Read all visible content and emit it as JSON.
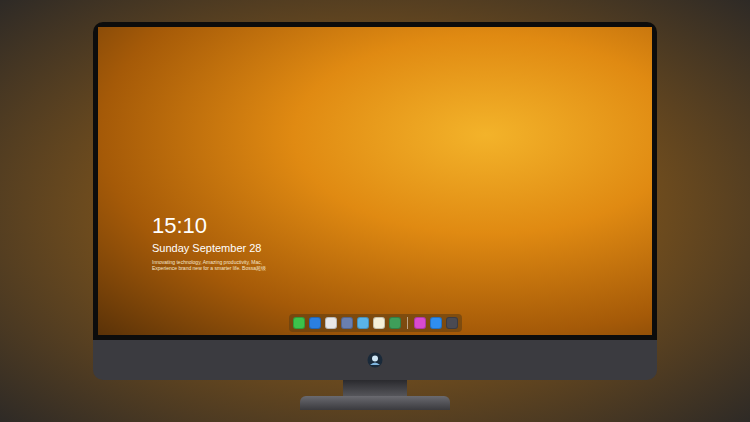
{
  "screen": {
    "clock": {
      "time": "15:10",
      "date": "Sunday September 28",
      "tagline": [
        "Innovating technology, Amazing productivity, Mac,",
        "Experience brand new for a smarter life. Bossa超级"
      ]
    }
  },
  "dock": {
    "items": [
      {
        "color": "#3cc24a"
      },
      {
        "color": "#2a7fe0"
      },
      {
        "color": "#e8e8e8"
      },
      {
        "color": "#6a7fb0"
      },
      {
        "color": "#5ab4e8"
      },
      {
        "color": "#f5f0d8"
      },
      {
        "color": "#3f9e5a"
      }
    ],
    "extra_items": [
      {
        "color": "#d94ad0"
      },
      {
        "color": "#2f8ef0"
      },
      {
        "color": "#4a4a52"
      }
    ]
  }
}
